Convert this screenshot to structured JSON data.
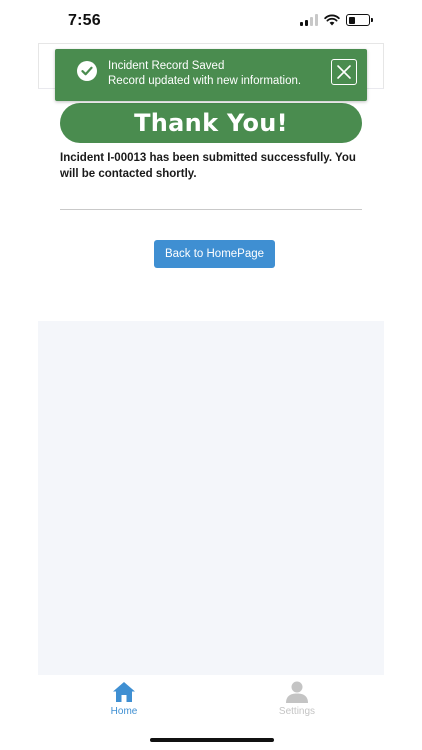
{
  "status_bar": {
    "time": "7:56"
  },
  "toast": {
    "title": "Incident Record Saved",
    "message": "Record updated with new information."
  },
  "confirmation": {
    "heading": "Thank You!",
    "message": "Incident I-00013 has been submitted successfully. You will be contacted shortly.",
    "back_button_label": "Back to HomePage"
  },
  "bottom_nav": {
    "items": [
      {
        "label": "Home",
        "icon": "home-icon",
        "active": true
      },
      {
        "label": "Settings",
        "icon": "user-icon",
        "active": false
      }
    ]
  },
  "colors": {
    "success_green": "#4a8c4f",
    "primary_blue": "#3f8fd2",
    "inactive_gray": "#c4c4c4",
    "page_background": "#f4f6fa"
  }
}
